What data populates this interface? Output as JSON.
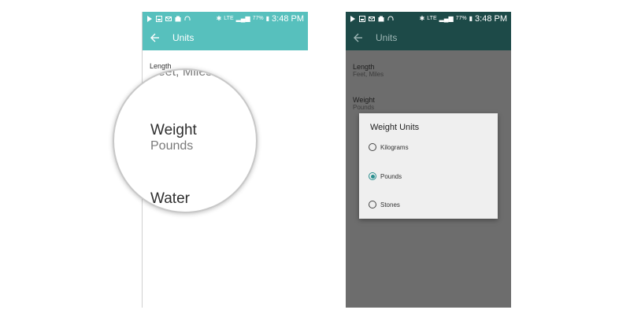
{
  "status_bar": {
    "time": "3:48 PM",
    "battery": "77%",
    "network": "LTE",
    "icons": [
      "play-icon",
      "image-icon",
      "mail-icon",
      "gallery-icon",
      "headset-icon"
    ]
  },
  "left_screen": {
    "title": "Units",
    "settings": [
      {
        "label": "Length",
        "value": "Feet, Miles"
      }
    ],
    "magnifier": {
      "items": [
        {
          "label": "Weight",
          "value": "Pounds"
        },
        {
          "label": "Water",
          "value": ""
        }
      ]
    }
  },
  "right_screen": {
    "title": "Units",
    "settings": [
      {
        "label": "Length",
        "value": "Feet, Miles"
      },
      {
        "label": "Weight",
        "value": "Pounds"
      }
    ],
    "dialog": {
      "title": "Weight Units",
      "options": [
        {
          "label": "Kilograms",
          "selected": false
        },
        {
          "label": "Pounds",
          "selected": true
        },
        {
          "label": "Stones",
          "selected": false
        }
      ]
    }
  },
  "colors": {
    "teal_bar": "#57c0bd",
    "dark_bar": "#1d4a48",
    "dim_overlay": "#6d6d6d",
    "radio_accent": "#2a8f8f"
  }
}
